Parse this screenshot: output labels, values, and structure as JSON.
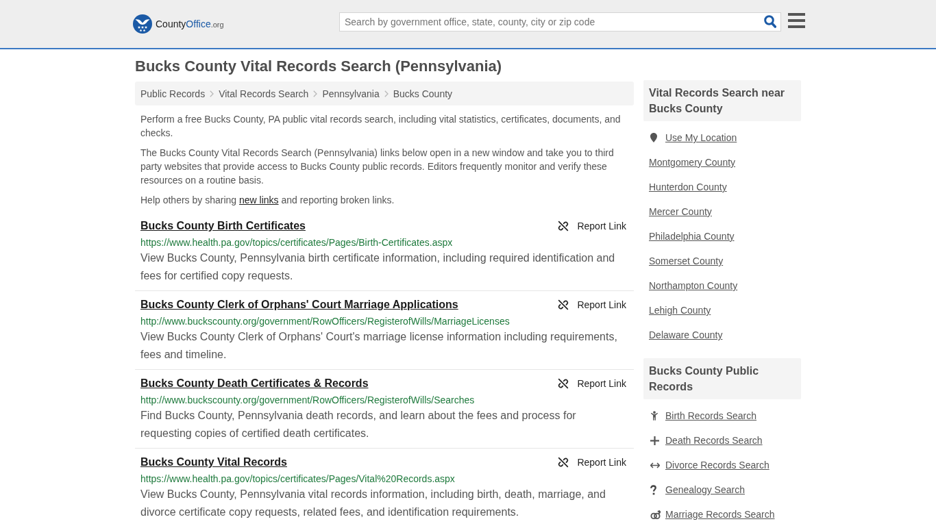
{
  "header": {
    "logo": {
      "text": "County",
      "highlight": "Office",
      "suffix": ".org"
    },
    "search": {
      "placeholder": "Search by government office, state, county, city or zip code"
    }
  },
  "page_title": "Bucks County Vital Records Search (Pennsylvania)",
  "breadcrumbs": [
    "Public Records",
    "Vital Records Search",
    "Pennsylvania",
    "Bucks County"
  ],
  "intro": [
    "Perform a free Bucks County, PA public vital records search, including vital statistics, certificates, documents, and checks.",
    "The Bucks County Vital Records Search (Pennsylvania) links below open in a new window and take you to third party websites that provide access to Bucks County public records. Editors frequently monitor and verify these resources on a routine basis."
  ],
  "share_note": {
    "before": "Help others by sharing ",
    "link": "new links",
    "after": " and reporting broken links."
  },
  "listings": [
    {
      "title": "Bucks County Birth Certificates",
      "url": "https://www.health.pa.gov/topics/certificates/Pages/Birth-Certificates.aspx",
      "description": "View Bucks County, Pennsylvania birth certificate information, including required identification and fees for certified copy requests.",
      "report": "Report Link"
    },
    {
      "title": "Bucks County Clerk of Orphans' Court Marriage Applications",
      "url": "http://www.buckscounty.org/government/RowOfficers/RegisterofWills/MarriageLicenses",
      "description": "View Bucks County Clerk of Orphans' Court's marriage license information including requirements, fees and timeline.",
      "report": "Report Link"
    },
    {
      "title": "Bucks County Death Certificates & Records",
      "url": "http://www.buckscounty.org/government/RowOfficers/RegisterofWills/Searches",
      "description": "Find Bucks County, Pennsylvania death records, and learn about the fees and process for requesting copies of certified death certificates.",
      "report": "Report Link"
    },
    {
      "title": "Bucks County Vital Records",
      "url": "https://www.health.pa.gov/topics/certificates/Pages/Vital%20Records.aspx",
      "description": "View Bucks County, Pennsylvania vital records information, including birth, death, marriage, and divorce certificate copy requests, related fees, and identification requirements.",
      "report": "Report Link"
    }
  ],
  "sidebar": {
    "nearby": {
      "title": "Vital Records Search near Bucks County",
      "location_link": "Use My Location",
      "counties": [
        "Montgomery County",
        "Hunterdon County",
        "Mercer County",
        "Philadelphia County",
        "Somerset County",
        "Northampton County",
        "Lehigh County",
        "Delaware County"
      ]
    },
    "public_records": {
      "title": "Bucks County Public Records",
      "items": [
        {
          "label": "Birth Records Search",
          "kind": "birth"
        },
        {
          "label": "Death Records Search",
          "kind": "death"
        },
        {
          "label": "Divorce Records Search",
          "kind": "divorce"
        },
        {
          "label": "Genealogy Search",
          "kind": "genealogy"
        },
        {
          "label": "Marriage Records Search",
          "kind": "marriage"
        }
      ]
    }
  }
}
